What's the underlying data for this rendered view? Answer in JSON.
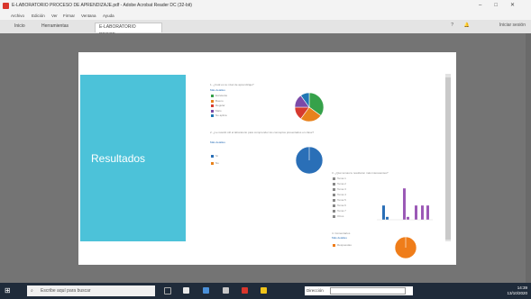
{
  "window": {
    "title": "E-LABORATORIO PROCESO DE APRENDIZAJE.pdf - Adobe Acrobat Reader DC (32-bit)",
    "controls": [
      "–",
      "□",
      "✕"
    ]
  },
  "menu": [
    "Archivo",
    "Edición",
    "Ver",
    "Firmar",
    "Ventana",
    "Ayuda"
  ],
  "tabs": {
    "home": "Inicio",
    "tools": "Herramientas",
    "document": "E-LABORATORIO PROCE...",
    "close": "×"
  },
  "toolbar_right": {
    "help": "?",
    "bell": "🔔",
    "signin": "Iniciar sesión"
  },
  "slide": {
    "side_title": "Resultados",
    "chart1": {
      "question": "1. ¿Cuál es su nivel de aprendizaje?",
      "link": "Más detalles",
      "legend": [
        "Excelente",
        "Bueno",
        "Regular",
        "Malo",
        "No aplica"
      ]
    },
    "chart2": {
      "question": "2. ¿Le resultó útil el laboratorio para comprender los conceptos presentados en clase?",
      "link": "Más detalles",
      "legend": [
        "Sí",
        "No"
      ]
    },
    "chart3": {
      "question": "3. ¿Qué temas le resultaron más interesantes?",
      "legend": [
        "Tema 1",
        "Tema 2",
        "Tema 3",
        "Tema 4",
        "Tema 5",
        "Tema 6",
        "Tema 7",
        "Otros"
      ]
    },
    "chart4": {
      "question": "4. Comentarios",
      "link": "Más detalles",
      "legend": [
        "Respuestas"
      ]
    }
  },
  "chart_data": [
    {
      "type": "pie",
      "categories": [
        "Excelente",
        "Bueno",
        "Regular",
        "Malo",
        "No aplica"
      ],
      "values": [
        35,
        25,
        15,
        15,
        10
      ],
      "colors": [
        "#36a14a",
        "#e8821c",
        "#d63a2f",
        "#7b4aa8",
        "#1f77b4"
      ]
    },
    {
      "type": "pie",
      "categories": [
        "Sí",
        "No"
      ],
      "values": [
        100,
        0
      ],
      "colors": [
        "#2a6fb7",
        "#e8821c"
      ]
    },
    {
      "type": "bar",
      "categories": [
        "1",
        "2",
        "3",
        "4",
        "5",
        "6",
        "7"
      ],
      "values": [
        5,
        1,
        11,
        1,
        5,
        5,
        5
      ],
      "colors": [
        "#2a6fb7",
        "#2a6fb7",
        "#9b59b6",
        "#9b59b6",
        "#9b59b6",
        "#9b59b6",
        "#9b59b6"
      ],
      "ylim": [
        0,
        12
      ]
    },
    {
      "type": "pie",
      "categories": [
        "Respuestas"
      ],
      "values": [
        100
      ],
      "colors": [
        "#ef7d1a"
      ]
    }
  ],
  "taskbar": {
    "search_placeholder": "Escribe aquí para buscar",
    "address_label": "Dirección",
    "time": "14:39",
    "date": "13/10/2020"
  },
  "colors": {
    "accent": "#4cc2d9",
    "taskbar": "#1f2b3a",
    "acrobat": "#d9362c"
  }
}
